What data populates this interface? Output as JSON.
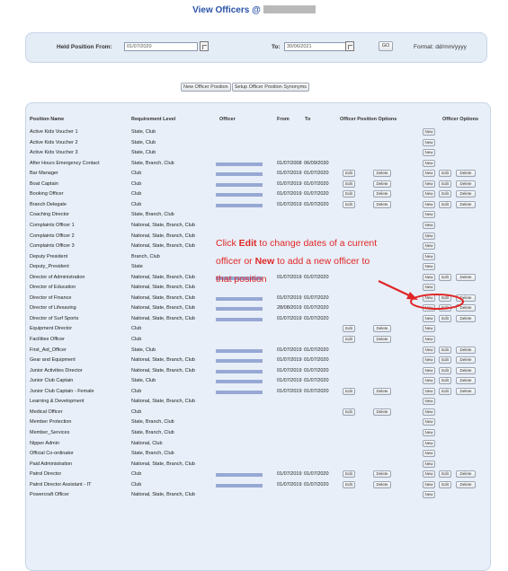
{
  "page": {
    "title": "View Officers @"
  },
  "filter": {
    "held_from_label": "Held Position From:",
    "held_from_value": "01/07/2020",
    "to_label": "To:",
    "to_value": "30/06/2021",
    "go_label": "GO",
    "format_label": "Format: dd/mm/yyyy"
  },
  "actions": {
    "new_position": "New Officer Position",
    "setup_synonyms": "Setup Officer Position Synonyms"
  },
  "table": {
    "headers": [
      "Position Name",
      "Requirement Level",
      "Officer",
      "From",
      "To",
      "Officer Position Options",
      "Officer Options"
    ],
    "btn_new": "New",
    "btn_edit": "Edit",
    "btn_delete": "Delete",
    "rows": [
      {
        "name": "Active Kids Voucher 1",
        "level": "State, Club",
        "officer": false,
        "from": "",
        "to": "",
        "pos_opts": false,
        "off_opts": false
      },
      {
        "name": "Active Kids Voucher 2",
        "level": "State, Club",
        "officer": false,
        "from": "",
        "to": "",
        "pos_opts": false,
        "off_opts": false
      },
      {
        "name": "Active Kids Voucher 3",
        "level": "State, Club",
        "officer": false,
        "from": "",
        "to": "",
        "pos_opts": false,
        "off_opts": false
      },
      {
        "name": "After Hours Emergency Contact",
        "level": "State, Branch, Club",
        "officer": true,
        "from": "01/07/2008",
        "to": "06/09/2030",
        "pos_opts": false,
        "off_opts": false
      },
      {
        "name": "Bar Manager",
        "level": "Club",
        "officer": true,
        "from": "01/07/2019",
        "to": "01/07/2020",
        "pos_opts": true,
        "off_opts": true
      },
      {
        "name": "Boat Captain",
        "level": "Club",
        "officer": true,
        "from": "01/07/2019",
        "to": "01/07/2020",
        "pos_opts": true,
        "off_opts": true
      },
      {
        "name": "Booking Officer",
        "level": "Club",
        "officer": true,
        "from": "01/07/2019",
        "to": "01/07/2020",
        "pos_opts": true,
        "off_opts": true
      },
      {
        "name": "Branch Delegate",
        "level": "Club",
        "officer": true,
        "from": "01/07/2019",
        "to": "01/07/2020",
        "pos_opts": true,
        "off_opts": true
      },
      {
        "name": "Coaching Director",
        "level": "State, Branch, Club",
        "officer": false,
        "from": "",
        "to": "",
        "pos_opts": false,
        "off_opts": false
      },
      {
        "name": "Complaints Officer 1",
        "level": "National, State, Branch, Club",
        "officer": false,
        "from": "",
        "to": "",
        "pos_opts": false,
        "off_opts": false
      },
      {
        "name": "Complaints Officer 2",
        "level": "National, State, Branch, Club",
        "officer": false,
        "from": "",
        "to": "",
        "pos_opts": false,
        "off_opts": false
      },
      {
        "name": "Complaints Officer 3",
        "level": "National, State, Branch, Club",
        "officer": false,
        "from": "",
        "to": "",
        "pos_opts": false,
        "off_opts": false
      },
      {
        "name": "Deputy President",
        "level": "Branch, Club",
        "officer": false,
        "from": "",
        "to": "",
        "pos_opts": false,
        "off_opts": false
      },
      {
        "name": "Deputy_President",
        "level": "State",
        "officer": false,
        "from": "",
        "to": "",
        "pos_opts": false,
        "off_opts": false
      },
      {
        "name": "Director of Administration",
        "level": "National, State, Branch, Club",
        "officer": true,
        "from": "01/07/2019",
        "to": "01/07/2020",
        "pos_opts": false,
        "off_opts": true
      },
      {
        "name": "Director of Education",
        "level": "National, State, Branch, Club",
        "officer": false,
        "from": "",
        "to": "",
        "pos_opts": false,
        "off_opts": false
      },
      {
        "name": "Director of Finance",
        "level": "National, State, Branch, Club",
        "officer": true,
        "from": "01/07/2019",
        "to": "01/07/2020",
        "pos_opts": false,
        "off_opts": true
      },
      {
        "name": "Director of Lifesaving",
        "level": "National, State, Branch, Club",
        "officer": true,
        "from": "28/08/2019",
        "to": "01/07/2020",
        "pos_opts": false,
        "off_opts": true
      },
      {
        "name": "Director of Surf Sports",
        "level": "National, State, Branch, Club",
        "officer": true,
        "from": "01/07/2019",
        "to": "01/07/2020",
        "pos_opts": false,
        "off_opts": true
      },
      {
        "name": "Equipment Director",
        "level": "Club",
        "officer": false,
        "from": "",
        "to": "",
        "pos_opts": true,
        "off_opts": false
      },
      {
        "name": "Facilities Officer",
        "level": "Club",
        "officer": false,
        "from": "",
        "to": "",
        "pos_opts": true,
        "off_opts": false
      },
      {
        "name": "First_Aid_Officer",
        "level": "State, Club",
        "officer": true,
        "from": "01/07/2019",
        "to": "01/07/2020",
        "pos_opts": false,
        "off_opts": true
      },
      {
        "name": "Gear and Equipment",
        "level": "National, State, Branch, Club",
        "officer": true,
        "from": "01/07/2019",
        "to": "01/07/2020",
        "pos_opts": false,
        "off_opts": true
      },
      {
        "name": "Junior Activities Director",
        "level": "National, State, Branch, Club",
        "officer": true,
        "from": "01/07/2019",
        "to": "01/07/2020",
        "pos_opts": false,
        "off_opts": true
      },
      {
        "name": "Junior Club Captain",
        "level": "State, Club",
        "officer": true,
        "from": "01/07/2019",
        "to": "01/07/2020",
        "pos_opts": false,
        "off_opts": true
      },
      {
        "name": "Junior Club Captain - Female",
        "level": "Club",
        "officer": true,
        "from": "01/07/2019",
        "to": "01/07/2020",
        "pos_opts": true,
        "off_opts": true
      },
      {
        "name": "Learning & Development",
        "level": "National, State, Branch, Club",
        "officer": false,
        "from": "",
        "to": "",
        "pos_opts": false,
        "off_opts": false
      },
      {
        "name": "Medical Officer",
        "level": "Club",
        "officer": false,
        "from": "",
        "to": "",
        "pos_opts": true,
        "off_opts": false
      },
      {
        "name": "Member Protection",
        "level": "State, Branch, Club",
        "officer": false,
        "from": "",
        "to": "",
        "pos_opts": false,
        "off_opts": false
      },
      {
        "name": "Member_Services",
        "level": "State, Branch, Club",
        "officer": false,
        "from": "",
        "to": "",
        "pos_opts": false,
        "off_opts": false
      },
      {
        "name": "Nipper Admin",
        "level": "National, Club",
        "officer": false,
        "from": "",
        "to": "",
        "pos_opts": false,
        "off_opts": false
      },
      {
        "name": "Official Co-ordinator",
        "level": "State, Branch, Club",
        "officer": false,
        "from": "",
        "to": "",
        "pos_opts": false,
        "off_opts": false
      },
      {
        "name": "Paid Administration",
        "level": "National, State, Branch, Club",
        "officer": false,
        "from": "",
        "to": "",
        "pos_opts": false,
        "off_opts": false
      },
      {
        "name": "Patrol Director",
        "level": "Club",
        "officer": true,
        "from": "01/07/2019",
        "to": "01/07/2020",
        "pos_opts": true,
        "off_opts": true
      },
      {
        "name": "Patrol Director Assistant - IT",
        "level": "Club",
        "officer": true,
        "from": "01/07/2019",
        "to": "01/07/2020",
        "pos_opts": true,
        "off_opts": true
      },
      {
        "name": "Powercraft Officer",
        "level": "National, State, Branch, Club",
        "officer": false,
        "from": "",
        "to": "",
        "pos_opts": false,
        "off_opts": false
      }
    ]
  },
  "annotation": {
    "line1_pre": "Click ",
    "line1_bold": "Edit",
    "line1_post": " to change dates of a current",
    "line2_pre": "officer or ",
    "line2_bold": "New",
    "line2_post": " to add a new officer to",
    "line3": "that position",
    "color": "#e02626"
  }
}
